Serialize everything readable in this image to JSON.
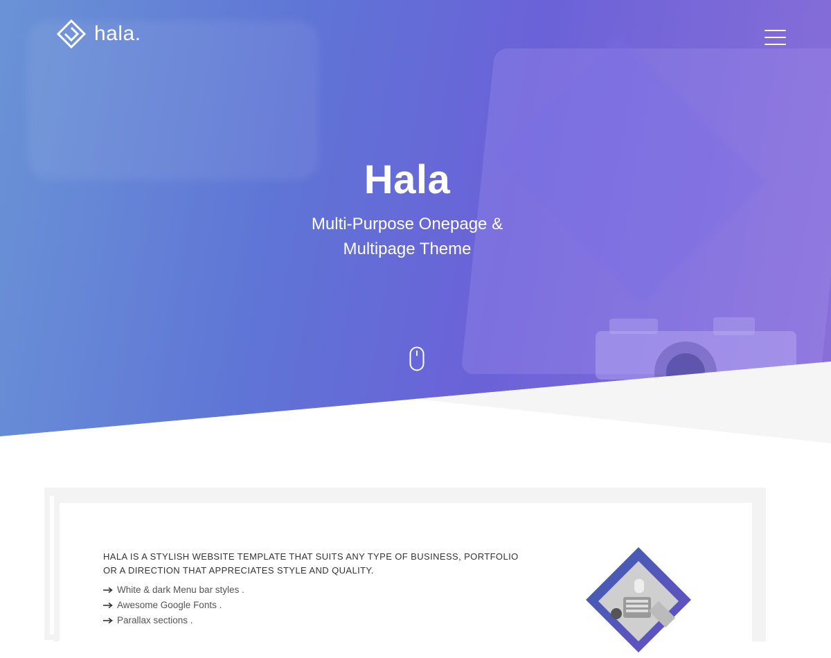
{
  "brand": {
    "name": "hala."
  },
  "hero": {
    "title": "Hala",
    "subtitle_line1": "Multi-Purpose Onepage &",
    "subtitle_line2": "Multipage Theme"
  },
  "about": {
    "intro": "HALA IS A STYLISH WEBSITE TEMPLATE THAT SUITS ANY TYPE OF BUSINESS, PORTFOLIO OR A DIRECTION THAT APPRECIATES STYLE AND QUALITY.",
    "features": [
      "White & dark Menu bar styles .",
      "Awesome Google Fonts .",
      "Parallax sections ."
    ]
  },
  "icons": {
    "logo": "diamond-logo-icon",
    "menu": "hamburger-menu-icon",
    "scroll": "mouse-scroll-icon",
    "list_bullet": "long-arrow-right-icon"
  },
  "colors": {
    "hero_gradient_start": "#6a93d6",
    "hero_gradient_end": "#8a6fd8",
    "text_dark": "#333333",
    "card_border": "#f3f3f3"
  }
}
